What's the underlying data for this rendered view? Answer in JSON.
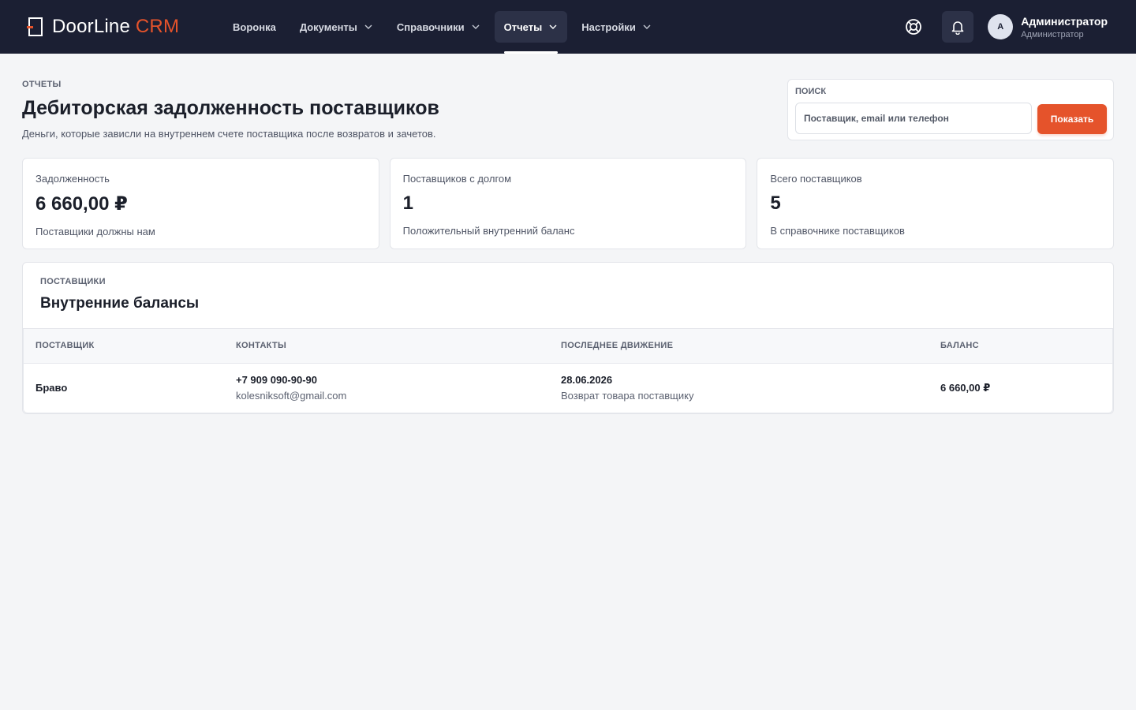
{
  "brand": {
    "name_main": "DoorLine",
    "name_accent": "CRM",
    "accent_color": "#e5532b",
    "topbar_color": "#1b1f33"
  },
  "nav": {
    "items": [
      {
        "label": "Воронка",
        "has_dropdown": false,
        "active": false
      },
      {
        "label": "Документы",
        "has_dropdown": true,
        "active": false
      },
      {
        "label": "Справочники",
        "has_dropdown": true,
        "active": false
      },
      {
        "label": "Отчеты",
        "has_dropdown": true,
        "active": true
      },
      {
        "label": "Настройки",
        "has_dropdown": true,
        "active": false
      }
    ]
  },
  "header_icons": {
    "help": "lifebuoy-icon",
    "notifications": "bell-icon"
  },
  "user": {
    "initial": "A",
    "name": "Администратор",
    "role": "Администратор"
  },
  "page": {
    "eyebrow": "ОТЧЕТЫ",
    "title": "Дебиторская задолженность поставщиков",
    "subtitle": "Деньги, которые зависли на внутреннем счете поставщика после возвратов и зачетов."
  },
  "search": {
    "label": "ПОИСК",
    "placeholder": "Поставщик, email или телефон",
    "value": "",
    "button": "Показать"
  },
  "stats": [
    {
      "label": "Задолженность",
      "value": "6 660,00 ₽",
      "note": "Поставщики должны нам"
    },
    {
      "label": "Поставщиков с долгом",
      "value": "1",
      "note": "Положительный внутренний баланс"
    },
    {
      "label": "Всего поставщиков",
      "value": "5",
      "note": "В справочнике поставщиков"
    }
  ],
  "balances": {
    "eyebrow": "ПОСТАВЩИКИ",
    "title": "Внутренние балансы",
    "columns": [
      "ПОСТАВЩИК",
      "КОНТАКТЫ",
      "ПОСЛЕДНЕЕ ДВИЖЕНИЕ",
      "БАЛАНС"
    ],
    "rows": [
      {
        "supplier": "Браво",
        "phone": "+7 909 090-90-90",
        "email": "kolesniksoft@gmail.com",
        "last_date": "28.06.2026",
        "last_action": "Возврат товара поставщику",
        "balance": "6 660,00 ₽"
      }
    ]
  }
}
